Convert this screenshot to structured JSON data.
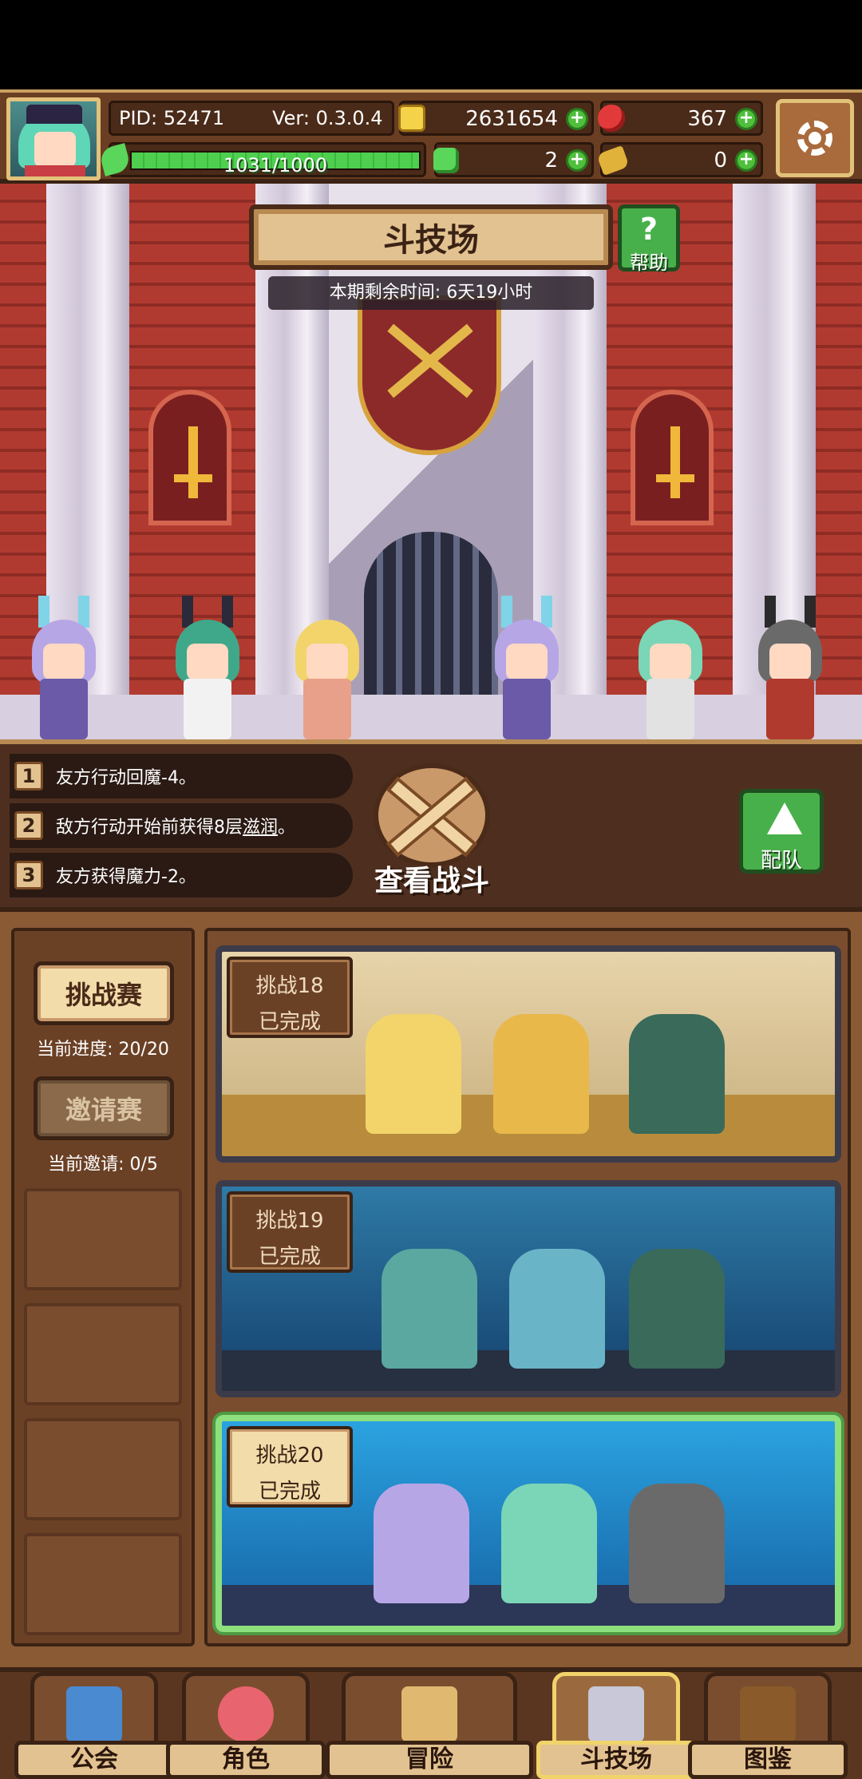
{
  "hud": {
    "pid": "PID: 52471",
    "version": "Ver: 0.3.0.4",
    "gold": "2631654",
    "gems": "367",
    "exp": "1031/1000",
    "exp_fraction": 1.0,
    "clover": "2",
    "bread": "0",
    "icons": [
      "avatar",
      "coin-icon",
      "gem-icon",
      "leaf-icon",
      "clover-icon",
      "bread-icon",
      "plus-icon",
      "gear-icon"
    ]
  },
  "arena": {
    "title": "斗技场",
    "help_icon": "?",
    "help_label": "帮助",
    "season_timer": "本期剩余时间: 6天19小时"
  },
  "rules": [
    {
      "num": "1",
      "text": "友方行动回魔-4。"
    },
    {
      "num": "2",
      "text_before": "敌方行动开始前获得8层",
      "text_link": "滋润",
      "text_after": "。"
    },
    {
      "num": "3",
      "text": "友方获得魔力-2。"
    }
  ],
  "view_battle_label": "查看战斗",
  "team_label": "配队",
  "tabs": {
    "challenge": {
      "label": "挑战赛",
      "caption": "当前进度: 20/20"
    },
    "invite": {
      "label": "邀请赛",
      "caption": "当前邀请: 0/5"
    }
  },
  "challenges": [
    {
      "name": "挑战18",
      "status": "已完成"
    },
    {
      "name": "挑战19",
      "status": "已完成"
    },
    {
      "name": "挑战20",
      "status": "已完成"
    }
  ],
  "nav": [
    {
      "label": "公会",
      "icon": "guild-icon"
    },
    {
      "label": "角色",
      "icon": "character-icon"
    },
    {
      "label": "冒险",
      "icon": "adventure-icon"
    },
    {
      "label": "斗技场",
      "icon": "arena-icon"
    },
    {
      "label": "图鉴",
      "icon": "codex-icon"
    }
  ],
  "colors": {
    "accent": "#48b04a",
    "frame": "#3a2214",
    "gold": "#e2c290"
  }
}
